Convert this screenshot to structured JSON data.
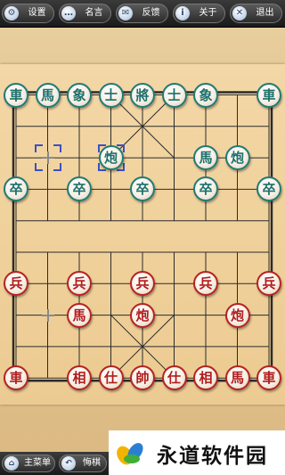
{
  "toolbar": {
    "settings": {
      "label": "设置",
      "icon": "gear-icon",
      "glyph": "⚙"
    },
    "famous": {
      "label": "名言",
      "icon": "chat-icon",
      "glyph": "…"
    },
    "feedback": {
      "label": "反馈",
      "icon": "mail-icon",
      "glyph": "✉"
    },
    "about": {
      "label": "关于",
      "icon": "info-icon",
      "glyph": "i"
    },
    "exit": {
      "label": "退出",
      "icon": "close-icon",
      "glyph": "✕"
    }
  },
  "board": {
    "files": 9,
    "ranks": 10,
    "river_text": "",
    "colors": {
      "line": "#2b2b2b",
      "green": "#1f6f6b",
      "red": "#b21c1c",
      "selection": "#3b4fc8"
    },
    "pieces": [
      {
        "side": "green",
        "char": "車",
        "file": 0,
        "rank": 0
      },
      {
        "side": "green",
        "char": "馬",
        "file": 1,
        "rank": 0
      },
      {
        "side": "green",
        "char": "象",
        "file": 2,
        "rank": 0
      },
      {
        "side": "green",
        "char": "士",
        "file": 3,
        "rank": 0
      },
      {
        "side": "green",
        "char": "將",
        "file": 4,
        "rank": 0
      },
      {
        "side": "green",
        "char": "士",
        "file": 5,
        "rank": 0
      },
      {
        "side": "green",
        "char": "象",
        "file": 6,
        "rank": 0
      },
      {
        "side": "green",
        "char": "車",
        "file": 8,
        "rank": 0
      },
      {
        "side": "green",
        "char": "炮",
        "file": 3,
        "rank": 2
      },
      {
        "side": "green",
        "char": "馬",
        "file": 6,
        "rank": 2
      },
      {
        "side": "green",
        "char": "炮",
        "file": 7,
        "rank": 2
      },
      {
        "side": "green",
        "char": "卒",
        "file": 0,
        "rank": 3
      },
      {
        "side": "green",
        "char": "卒",
        "file": 2,
        "rank": 3
      },
      {
        "side": "green",
        "char": "卒",
        "file": 4,
        "rank": 3
      },
      {
        "side": "green",
        "char": "卒",
        "file": 6,
        "rank": 3
      },
      {
        "side": "green",
        "char": "卒",
        "file": 8,
        "rank": 3
      },
      {
        "side": "red",
        "char": "兵",
        "file": 0,
        "rank": 6
      },
      {
        "side": "red",
        "char": "兵",
        "file": 2,
        "rank": 6
      },
      {
        "side": "red",
        "char": "兵",
        "file": 4,
        "rank": 6
      },
      {
        "side": "red",
        "char": "兵",
        "file": 6,
        "rank": 6
      },
      {
        "side": "red",
        "char": "兵",
        "file": 8,
        "rank": 6
      },
      {
        "side": "red",
        "char": "馬",
        "file": 2,
        "rank": 7
      },
      {
        "side": "red",
        "char": "炮",
        "file": 4,
        "rank": 7
      },
      {
        "side": "red",
        "char": "炮",
        "file": 7,
        "rank": 7
      },
      {
        "side": "red",
        "char": "車",
        "file": 0,
        "rank": 9
      },
      {
        "side": "red",
        "char": "相",
        "file": 2,
        "rank": 9
      },
      {
        "side": "red",
        "char": "仕",
        "file": 3,
        "rank": 9
      },
      {
        "side": "red",
        "char": "帥",
        "file": 4,
        "rank": 9
      },
      {
        "side": "red",
        "char": "仕",
        "file": 5,
        "rank": 9
      },
      {
        "side": "red",
        "char": "相",
        "file": 6,
        "rank": 9
      },
      {
        "side": "red",
        "char": "馬",
        "file": 7,
        "rank": 9
      },
      {
        "side": "red",
        "char": "車",
        "file": 8,
        "rank": 9
      }
    ],
    "last_move": {
      "from": {
        "file": 1,
        "rank": 2
      },
      "to": {
        "file": 3,
        "rank": 2
      }
    },
    "empty_markers": [
      {
        "file": 1,
        "rank": 7
      }
    ]
  },
  "bottom": {
    "main_menu": {
      "label": "主菜单",
      "icon": "home-icon",
      "glyph": "⌂"
    },
    "undo": {
      "label": "悔棋",
      "icon": "undo-icon",
      "glyph": "↶"
    }
  },
  "watermark": {
    "text": "永道软件园",
    "logo": "leaf-logo"
  }
}
